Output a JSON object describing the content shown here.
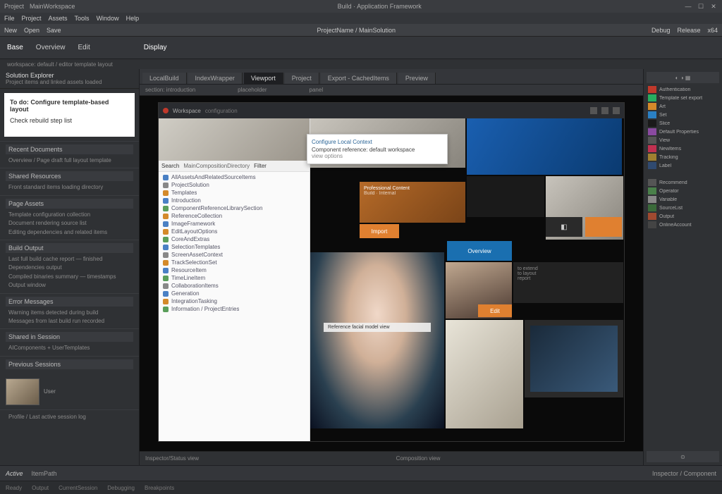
{
  "titlebar": {
    "app": "Project",
    "doc": "MainWorkspace",
    "center": "Build · Application Framework",
    "right": [
      "==",
      "=",
      "≡"
    ]
  },
  "menubar": [
    "File",
    "Project",
    "Assets",
    "Tools",
    "Window",
    "Help"
  ],
  "toolbar": {
    "left": [
      "New",
      "Open",
      "Save"
    ],
    "center": "ProjectName / MainSolution",
    "right": [
      "Debug",
      "Release",
      "x64"
    ]
  },
  "ribbon": {
    "tabs": [
      "Base",
      "Overview",
      "Edit"
    ],
    "center": "Display",
    "active": 0
  },
  "subtitle": "workspace: default / editor template layout",
  "left": {
    "head": {
      "title": "Solution Explorer",
      "sub": "Project items and linked assets loaded"
    },
    "note": {
      "title": "To do: Configure template-based layout",
      "body": "Check rebuild step list"
    },
    "sections": [
      {
        "hd": "Recent Documents",
        "rows": [
          "Overview / Page draft full layout template"
        ]
      },
      {
        "hd": "Shared Resources",
        "rows": [
          "Front standard items loading directory"
        ]
      },
      {
        "hd": "Page Assets",
        "rows": [
          "Template configuration collection",
          "Document rendering source list",
          "Editing dependencies and related items"
        ]
      },
      {
        "hd": "Build Output",
        "rows": [
          "Last full build cache report — finished",
          "Dependencies output",
          "Compiled binaries summary — timestamps",
          "Output window"
        ]
      },
      {
        "hd": "Error Messages",
        "rows": [
          "Warning items detected during build",
          "Messages from last build run recorded"
        ]
      },
      {
        "hd": "Shared in Session",
        "rows": [
          "AIComponents + UserTemplates"
        ]
      },
      {
        "hd": "Previous Sessions",
        "rows": []
      }
    ],
    "thumb": {
      "label": "User",
      "caption": "Profile / Last active session log"
    }
  },
  "center": {
    "tabs": [
      "LocalBuild",
      "IndexWrapper",
      "Viewport",
      "Project",
      "Export - CachedItems",
      "Preview"
    ],
    "activeTab": 2,
    "crumb": [
      "section: introduction",
      "placeholder",
      "panel"
    ],
    "canvas": {
      "topbar": {
        "title": "Workspace",
        "sub": "configuration"
      },
      "popup": {
        "link": "Configure Local Context",
        "text1": "Component reference: default workspace",
        "text2": "view options"
      },
      "treebar": [
        "Search",
        "MainCompositionDirectory",
        "Filter"
      ],
      "tree": [
        {
          "c": "b",
          "t": "AllAssetsAndRelatedSourceItems"
        },
        {
          "c": "g",
          "t": "ProjectSolution"
        },
        {
          "c": "o",
          "t": "Templates"
        },
        {
          "c": "b",
          "t": "Introduction"
        },
        {
          "c": "",
          "t": "ComponentReferenceLibrarySection"
        },
        {
          "c": "o",
          "t": "ReferenceCollection"
        },
        {
          "c": "b",
          "t": "ImageFramework"
        },
        {
          "c": "o",
          "t": "EditLayoutOptions"
        },
        {
          "c": "",
          "t": "CoreAndExtras"
        },
        {
          "c": "b",
          "t": "SelectionTemplates"
        },
        {
          "c": "g",
          "t": "ScreenAssetContext"
        },
        {
          "c": "o",
          "t": "TrackSelectionSet"
        },
        {
          "c": "b",
          "t": "ResourceItem"
        },
        {
          "c": "",
          "t": "TimeLineItem"
        },
        {
          "c": "g",
          "t": "CollaborationItems"
        },
        {
          "c": "b",
          "t": "Generation"
        },
        {
          "c": "o",
          "t": "IntegrationTasking"
        },
        {
          "c": "",
          "t": "Information / ProjectEntries"
        }
      ],
      "tiles": {
        "orange_label": "Professional Content",
        "orange_sub": "Build · Internal",
        "btn_orange1": "Import",
        "blue_label": "Overview",
        "btn_orange2": "Edit",
        "dark_lines": [
          "to extend",
          "to layout",
          "report"
        ],
        "face_overlay": "Reference facial model view"
      }
    },
    "bottom": "Composition view",
    "footer": "Inspector/Status view"
  },
  "right": {
    "items": [
      {
        "c": "#c0392b",
        "t": "Authentication"
      },
      {
        "c": "#27ae60",
        "t": "Template set export"
      },
      {
        "c": "#d48a2a",
        "t": "Art"
      },
      {
        "c": "#2a80c4",
        "t": "Set"
      },
      {
        "c": "#1a1a1a",
        "t": "Slice"
      },
      {
        "c": "#8a4aa0",
        "t": "Default Properties"
      },
      {
        "c": "#555",
        "t": "View"
      },
      {
        "c": "#c03050",
        "t": "NewItems"
      },
      {
        "c": "#a08030",
        "t": "Tracking"
      },
      {
        "c": "#304a70",
        "t": "Label"
      }
    ],
    "items2": [
      {
        "c": "#555",
        "t": "Recommend"
      },
      {
        "c": "#4a804a",
        "t": "Operator"
      },
      {
        "c": "#888",
        "t": "Variable"
      },
      {
        "c": "#3a6a3a",
        "t": "SourceList"
      },
      {
        "c": "#a04a30",
        "t": "Output"
      },
      {
        "c": "#444",
        "t": "OnlineAccount"
      }
    ]
  },
  "status": {
    "left": "Active",
    "item": "ItemPath",
    "right": "Inspector / Component"
  },
  "bottom": [
    "Ready",
    "Output",
    "CurrentSession",
    "Debugging",
    "Breakpoints"
  ]
}
